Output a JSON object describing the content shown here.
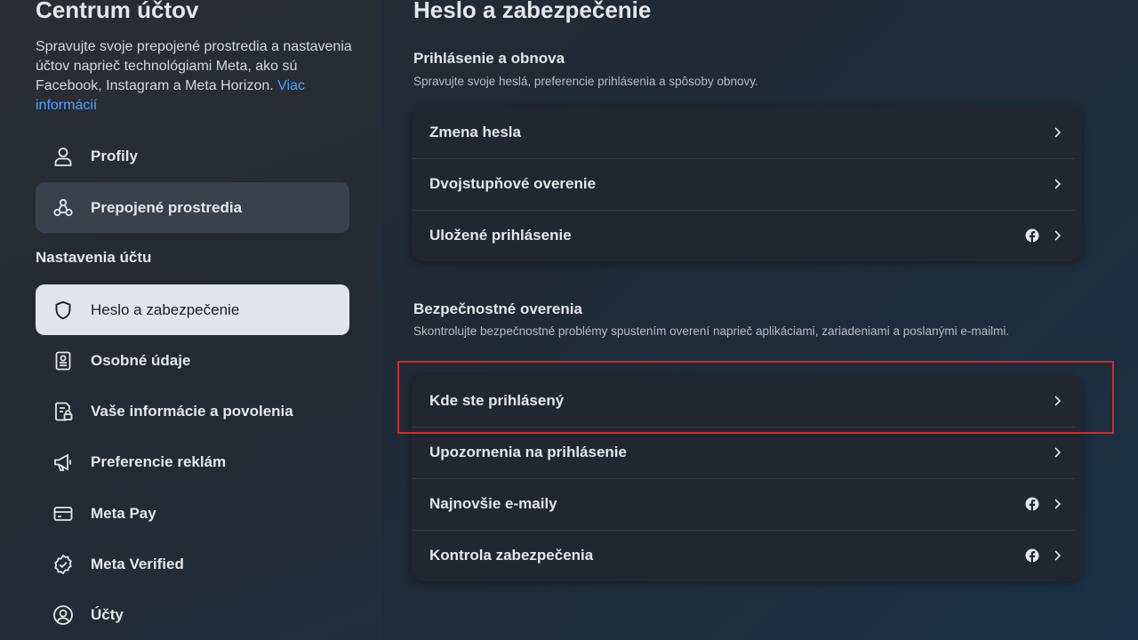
{
  "sidebar": {
    "title": "Centrum účtov",
    "description": "Spravujte svoje prepojené prostredia a nastavenia účtov naprieč technológiami Meta, ako sú Facebook, Instagram a Meta Horizon.",
    "more_info_link": "Viac informácií",
    "top_items": [
      {
        "label": "Profily",
        "icon": "person-icon"
      },
      {
        "label": "Prepojené prostredia",
        "icon": "connected-experiences-icon"
      }
    ],
    "section_label": "Nastavenia účtu",
    "settings_items": [
      {
        "label": "Heslo a zabezpečenie",
        "icon": "shield-icon"
      },
      {
        "label": "Osobné údaje",
        "icon": "id-card-icon"
      },
      {
        "label": "Vaše informácie a povolenia",
        "icon": "info-permissions-icon"
      },
      {
        "label": "Preferencie reklám",
        "icon": "megaphone-icon"
      },
      {
        "label": "Meta Pay",
        "icon": "credit-card-icon"
      },
      {
        "label": "Meta Verified",
        "icon": "verified-badge-icon"
      },
      {
        "label": "Účty",
        "icon": "account-circle-icon"
      }
    ]
  },
  "main": {
    "title": "Heslo a zabezpečenie",
    "login_section": {
      "title": "Prihlásenie a obnova",
      "description": "Spravujte svoje heslá, preferencie prihlásenia a spôsoby obnovy.",
      "rows": [
        {
          "label": "Zmena hesla",
          "facebook_icon": false
        },
        {
          "label": "Dvojstupňové overenie",
          "facebook_icon": false
        },
        {
          "label": "Uložené prihlásenie",
          "facebook_icon": true
        }
      ]
    },
    "security_section": {
      "title": "Bezpečnostné overenia",
      "description": "Skontrolujte bezpečnostné problémy spustením overení naprieč aplikáciami, zariadeniami a poslanými e-mailmi.",
      "rows": [
        {
          "label": "Kde ste prihlásený",
          "facebook_icon": false
        },
        {
          "label": "Upozornenia na prihlásenie",
          "facebook_icon": false
        },
        {
          "label": "Najnovšie e-maily",
          "facebook_icon": true
        },
        {
          "label": "Kontrola zabezpečenia",
          "facebook_icon": true
        }
      ]
    }
  },
  "colors": {
    "link": "#4ea1ff",
    "highlight": "#d62828",
    "selected_bg": "#e1e4ea"
  }
}
